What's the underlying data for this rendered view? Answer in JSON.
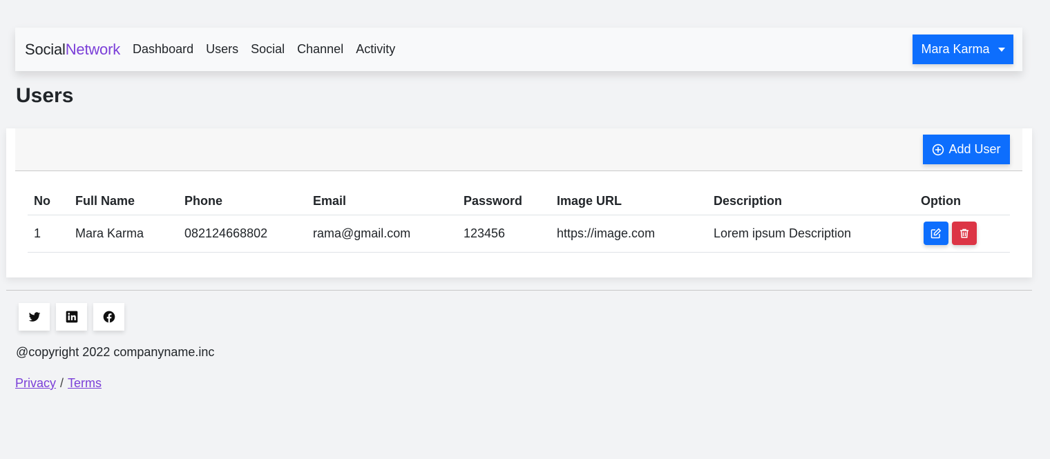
{
  "navbar": {
    "brand_part1": "Social",
    "brand_part2": "Network",
    "links": [
      "Dashboard",
      "Users",
      "Social",
      "Channel",
      "Activity"
    ],
    "user_name": "Mara Karma"
  },
  "page": {
    "title": "Users"
  },
  "card": {
    "add_button_label": "Add User"
  },
  "table": {
    "headers": [
      "No",
      "Full Name",
      "Phone",
      "Email",
      "Password",
      "Image URL",
      "Description",
      "Option"
    ],
    "rows": [
      {
        "no": "1",
        "full_name": "Mara Karma",
        "phone": "082124668802",
        "email": "rama@gmail.com",
        "password": "123456",
        "image_url": "https://image.com",
        "description": "Lorem ipsum Description"
      }
    ]
  },
  "footer": {
    "socials": [
      "twitter-icon",
      "linkedin-icon",
      "facebook-icon"
    ],
    "copyright": "@copyright 2022 companyname.inc",
    "privacy": "Privacy",
    "separator": "/",
    "terms": "Terms"
  },
  "colors": {
    "primary": "#0d6efd",
    "danger": "#dc3545",
    "accent": "#7b3fd8",
    "background": "#f2f3f5"
  }
}
